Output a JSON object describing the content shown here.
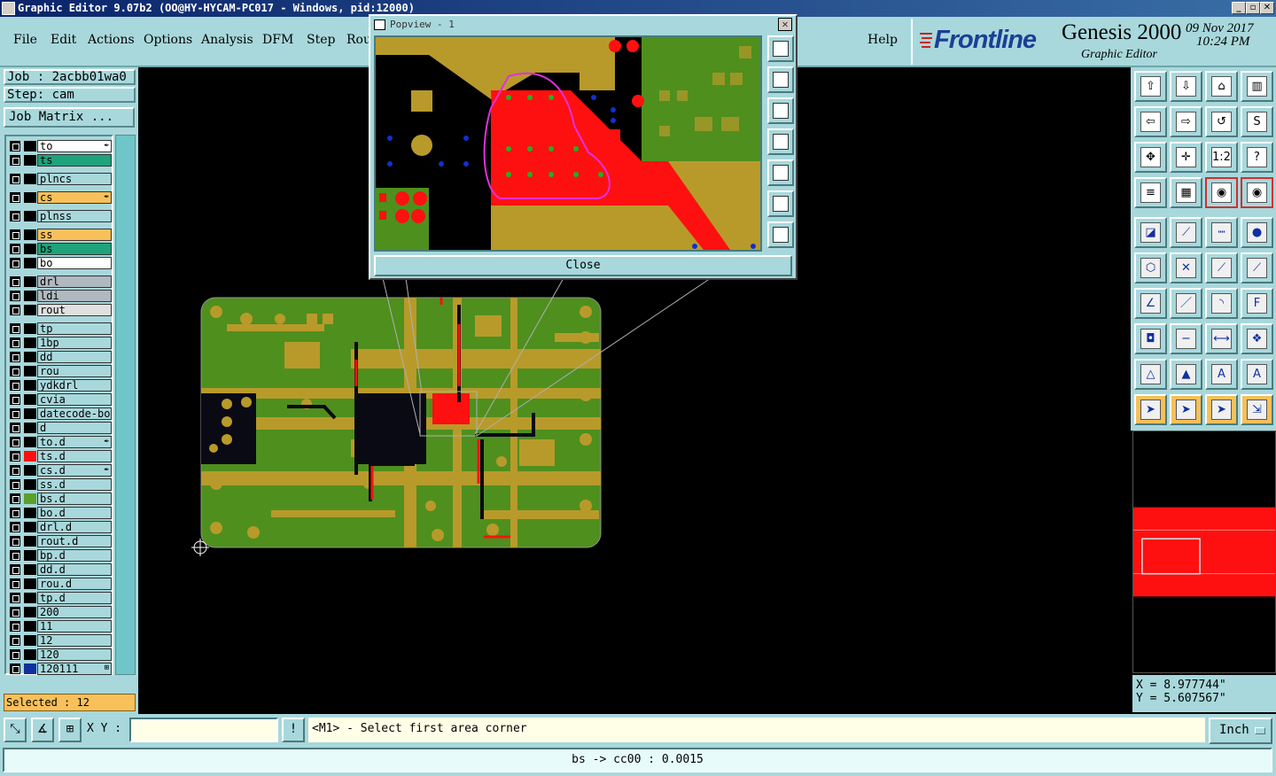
{
  "window": {
    "title": "Graphic Editor 9.07b2 (OO@HY-HYCAM-PC017 - Windows, pid:12000)"
  },
  "menu": {
    "items": [
      "File",
      "Edit",
      "Actions",
      "Options",
      "Analysis",
      "DFM",
      "Step",
      "Rou"
    ],
    "help": "Help"
  },
  "brand": {
    "logo": "Frontline",
    "product": "Genesis 2000",
    "subtitle": "Graphic Editor",
    "date": "09 Nov 2017",
    "time": "10:24 PM"
  },
  "job": {
    "job_label": "Job : 2acbb01wa0",
    "step_label": "Step: cam",
    "matrix_button": "Job Matrix ..."
  },
  "layers": [
    {
      "name": "to",
      "bg": "#ffffff",
      "swatch": "#000000",
      "mark": "✒"
    },
    {
      "name": "ts",
      "bg": "#1ea37a",
      "swatch": "#000000",
      "mark": ""
    },
    {
      "name": "plncs",
      "bg": "#a8d8dc",
      "swatch": "#000000",
      "mark": ""
    },
    {
      "name": "cs",
      "bg": "#f7c05a",
      "swatch": "#000000",
      "mark": "✒"
    },
    {
      "name": "plnss",
      "bg": "#a8d8dc",
      "swatch": "#000000",
      "mark": ""
    },
    {
      "name": "ss",
      "bg": "#f7c05a",
      "swatch": "#000000",
      "mark": ""
    },
    {
      "name": "bs",
      "bg": "#1ea37a",
      "swatch": "#000000",
      "mark": ""
    },
    {
      "name": "bo",
      "bg": "#ffffff",
      "swatch": "#000000",
      "mark": ""
    },
    {
      "name": "drl",
      "bg": "#b0b8c0",
      "swatch": "#000000",
      "mark": ""
    },
    {
      "name": "ldi",
      "bg": "#b0b8c0",
      "swatch": "#000000",
      "mark": ""
    },
    {
      "name": "rout",
      "bg": "#e0e0e0",
      "swatch": "#000000",
      "mark": ""
    },
    {
      "name": "tp",
      "bg": "#a8d8dc",
      "swatch": "#000000",
      "mark": ""
    },
    {
      "name": "1bp",
      "bg": "#a8d8dc",
      "swatch": "#000000",
      "mark": ""
    },
    {
      "name": "dd",
      "bg": "#a8d8dc",
      "swatch": "#000000",
      "mark": ""
    },
    {
      "name": "rou",
      "bg": "#a8d8dc",
      "swatch": "#000000",
      "mark": ""
    },
    {
      "name": "ydkdrl",
      "bg": "#a8d8dc",
      "swatch": "#000000",
      "mark": ""
    },
    {
      "name": "cvia",
      "bg": "#a8d8dc",
      "swatch": "#000000",
      "mark": ""
    },
    {
      "name": "datecode-bo",
      "bg": "#a8d8dc",
      "swatch": "#000000",
      "mark": ""
    },
    {
      "name": "d",
      "bg": "#a8d8dc",
      "swatch": "#000000",
      "mark": ""
    },
    {
      "name": "to.d",
      "bg": "#a8d8dc",
      "swatch": "#000000",
      "mark": "✒"
    },
    {
      "name": "ts.d",
      "bg": "#a8d8dc",
      "swatch": "#ff1010",
      "mark": ""
    },
    {
      "name": "cs.d",
      "bg": "#a8d8dc",
      "swatch": "#000000",
      "mark": "✒"
    },
    {
      "name": "ss.d",
      "bg": "#a8d8dc",
      "swatch": "#000000",
      "mark": ""
    },
    {
      "name": "bs.d",
      "bg": "#a8d8dc",
      "swatch": "#5aa02a",
      "mark": ""
    },
    {
      "name": "bo.d",
      "bg": "#a8d8dc",
      "swatch": "#000000",
      "mark": ""
    },
    {
      "name": "drl.d",
      "bg": "#a8d8dc",
      "swatch": "#000000",
      "mark": ""
    },
    {
      "name": "rout.d",
      "bg": "#a8d8dc",
      "swatch": "#000000",
      "mark": ""
    },
    {
      "name": "bp.d",
      "bg": "#a8d8dc",
      "swatch": "#000000",
      "mark": ""
    },
    {
      "name": "dd.d",
      "bg": "#a8d8dc",
      "swatch": "#000000",
      "mark": ""
    },
    {
      "name": "rou.d",
      "bg": "#a8d8dc",
      "swatch": "#000000",
      "mark": ""
    },
    {
      "name": "tp.d",
      "bg": "#a8d8dc",
      "swatch": "#000000",
      "mark": ""
    },
    {
      "name": "200",
      "bg": "#a8d8dc",
      "swatch": "#000000",
      "mark": ""
    },
    {
      "name": "11",
      "bg": "#a8d8dc",
      "swatch": "#000000",
      "mark": ""
    },
    {
      "name": "12",
      "bg": "#a8d8dc",
      "swatch": "#000000",
      "mark": ""
    },
    {
      "name": "120",
      "bg": "#a8d8dc",
      "swatch": "#000000",
      "mark": ""
    },
    {
      "name": "120111",
      "bg": "#a8d8dc",
      "swatch": "#1030a0",
      "mark": "⊞"
    }
  ],
  "selected": "Selected : 12",
  "popview": {
    "title": "Popview - 1",
    "close_label": "Close"
  },
  "coords": {
    "x": "X = 8.977744\"",
    "y": "Y = 5.607567\""
  },
  "command": {
    "xy_label": "X Y :",
    "xy_value": "",
    "prompt": "<M1> - Select first area corner",
    "units": "Inch"
  },
  "status": "bs -> cc00 : 0.0015",
  "colors": {
    "panel": "#a8d8dc",
    "board_green": "#4f8f1e",
    "copper": "#b89a2a",
    "highlight_red": "#ff1010",
    "active_orange": "#f7c05a"
  }
}
